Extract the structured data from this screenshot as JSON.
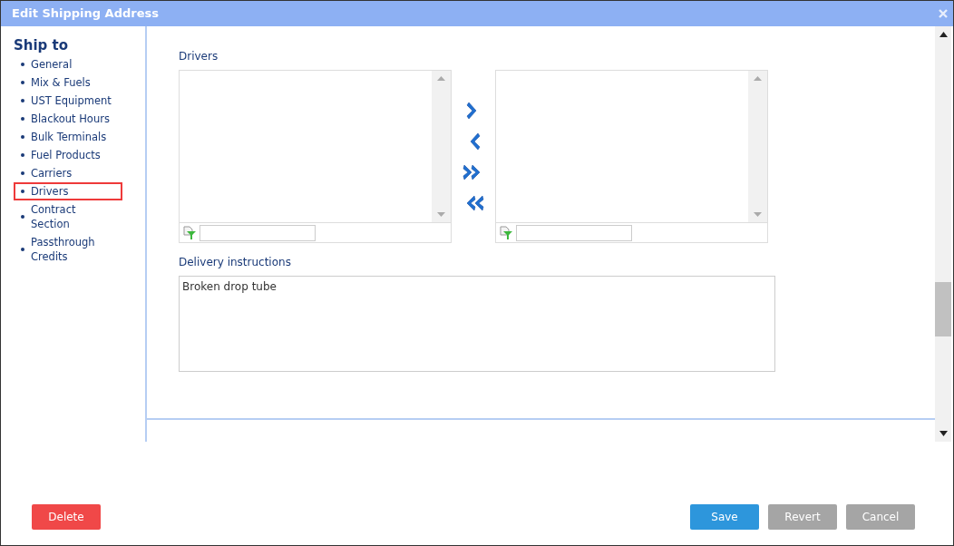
{
  "window": {
    "title": "Edit Shipping Address"
  },
  "sidebar": {
    "heading": "Ship to",
    "items": [
      {
        "label": "General",
        "selected": false
      },
      {
        "label": "Mix & Fuels",
        "selected": false
      },
      {
        "label": "UST Equipment",
        "selected": false
      },
      {
        "label": "Blackout Hours",
        "selected": false
      },
      {
        "label": "Bulk Terminals",
        "selected": false
      },
      {
        "label": "Fuel Products",
        "selected": false
      },
      {
        "label": "Carriers",
        "selected": false
      },
      {
        "label": "Drivers",
        "selected": true
      },
      {
        "label": "Contract Section",
        "selected": false
      },
      {
        "label": "Passthrough Credits",
        "selected": false
      }
    ]
  },
  "drivers": {
    "label": "Drivers"
  },
  "delivery_instructions": {
    "label": "Delivery instructions",
    "value": "Broken drop tube"
  },
  "buttons": [
    {
      "label": "Delete",
      "kind": "danger"
    },
    {
      "label": "Save",
      "kind": "primary"
    },
    {
      "label": "Revert",
      "kind": "secondary"
    },
    {
      "label": "Cancel",
      "kind": "secondary"
    }
  ]
}
